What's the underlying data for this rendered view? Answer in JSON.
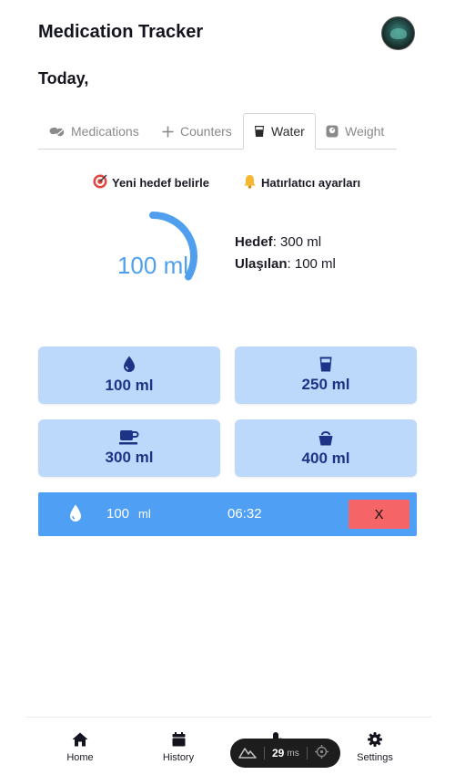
{
  "header": {
    "title": "Medication Tracker",
    "avatar_icon": "user-avatar"
  },
  "today_label": "Today,",
  "tabs": [
    {
      "label": "Medications",
      "icon": "pills-icon",
      "active": false
    },
    {
      "label": "Counters",
      "icon": "plus-icon",
      "active": false
    },
    {
      "label": "Water",
      "icon": "cup-icon",
      "active": true
    },
    {
      "label": "Weight",
      "icon": "scale-icon",
      "active": false
    }
  ],
  "actions": {
    "set_goal": "Yeni hedef belirle",
    "set_goal_icon": "target-icon",
    "reminder": "Hatırlatıcı ayarları",
    "reminder_icon": "bell-icon"
  },
  "progress": {
    "value_label": "100 ml",
    "fraction": 0.3333,
    "color": "#4f9fee"
  },
  "stats": {
    "goal_label": "Hedef",
    "goal_value": ": 300 ml",
    "achieved_label": "Ulaşılan",
    "achieved_value": ": 100 ml"
  },
  "quick_add": [
    {
      "label": "100 ml",
      "icon": "droplet-icon"
    },
    {
      "label": "250 ml",
      "icon": "glass-icon"
    },
    {
      "label": "300 ml",
      "icon": "mug-icon"
    },
    {
      "label": "400 ml",
      "icon": "bottle-icon"
    }
  ],
  "log": {
    "amount": "100",
    "unit": "ml",
    "time": "06:32",
    "delete_label": "X"
  },
  "bottom_nav": [
    {
      "label": "Home",
      "icon": "home-icon"
    },
    {
      "label": "History",
      "icon": "calendar-icon"
    },
    {
      "label": "",
      "icon": "pills-icon"
    },
    {
      "label": "Settings",
      "icon": "gear-icon"
    }
  ],
  "perf": {
    "value": "29",
    "unit": "ms"
  },
  "colors": {
    "accent": "#4f9ff4",
    "button_bg": "#bcd9fc",
    "button_text": "#1d3486",
    "delete": "#f56568"
  }
}
